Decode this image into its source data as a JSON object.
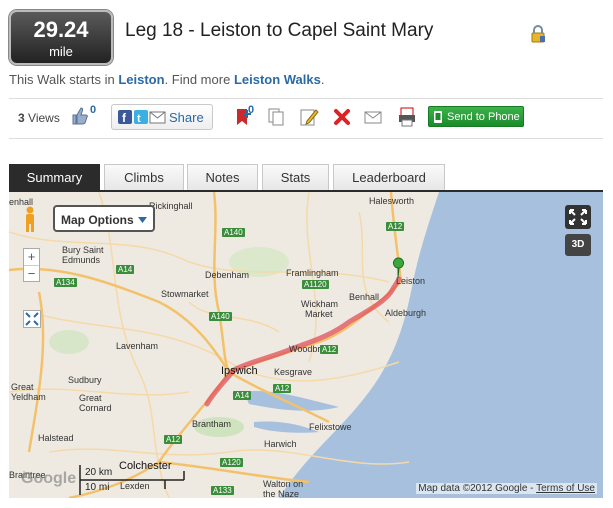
{
  "distance": {
    "value": "29.24",
    "unit": "mile"
  },
  "title": "Leg 18 - Leiston to Capel Saint Mary",
  "starts": {
    "prefix": "This Walk starts in",
    "town": "Leiston",
    "find_more": ". Find more",
    "walks_link": "Leiston Walks",
    "suffix": "."
  },
  "toolbar": {
    "views_count": "3",
    "views_label": "Views",
    "likes_count": "0",
    "share_label": "Share",
    "bookmark_count": "0",
    "send_to_phone": "Send to Phone"
  },
  "tabs": [
    "Summary",
    "Climbs",
    "Notes",
    "Stats",
    "Leaderboard"
  ],
  "map": {
    "options_label": "Map Options",
    "zoom_in": "+",
    "zoom_out": "−",
    "three_d": "3D",
    "scale_km": "20 km",
    "scale_mi": "10 mi",
    "attribution_prefix": "Map data ©2012 Google - ",
    "terms_link": "Terms of Use",
    "google_logo": "Google",
    "places": [
      {
        "name": "Rickinghall"
      },
      {
        "name": "Halesworth"
      },
      {
        "name": "Bury Saint"
      },
      {
        "name": "Edmunds"
      },
      {
        "name": "Debenham"
      },
      {
        "name": "Framlingham"
      },
      {
        "name": "Stowmarket"
      },
      {
        "name": "Leiston"
      },
      {
        "name": "Benhall"
      },
      {
        "name": "Wickham"
      },
      {
        "name": "Market"
      },
      {
        "name": "Aldeburgh"
      },
      {
        "name": "Lavenham"
      },
      {
        "name": "Woodbridge"
      },
      {
        "name": "Sudbury"
      },
      {
        "name": "Ipswich"
      },
      {
        "name": "Kesgrave"
      },
      {
        "name": "Great"
      },
      {
        "name": "Yeldham"
      },
      {
        "name": "Great"
      },
      {
        "name": "Cornard"
      },
      {
        "name": "Felixstowe"
      },
      {
        "name": "Brantham"
      },
      {
        "name": "Harwich"
      },
      {
        "name": "Halstead"
      },
      {
        "name": "Colchester"
      },
      {
        "name": "Braintree"
      },
      {
        "name": "Lexden"
      },
      {
        "name": "Walton on"
      },
      {
        "name": "the Naze"
      },
      {
        "name": "enhall"
      }
    ],
    "roads": [
      "A140",
      "A12",
      "A14",
      "A134",
      "A1120",
      "A140",
      "A12",
      "A14",
      "A12",
      "A120",
      "A133",
      "A12"
    ]
  },
  "colors": {
    "route": "#e0505a",
    "sea": "#a6c0dd",
    "land": "#eeeae2",
    "phone_btn": "#2a9d3a",
    "link": "#2a6aa5"
  }
}
